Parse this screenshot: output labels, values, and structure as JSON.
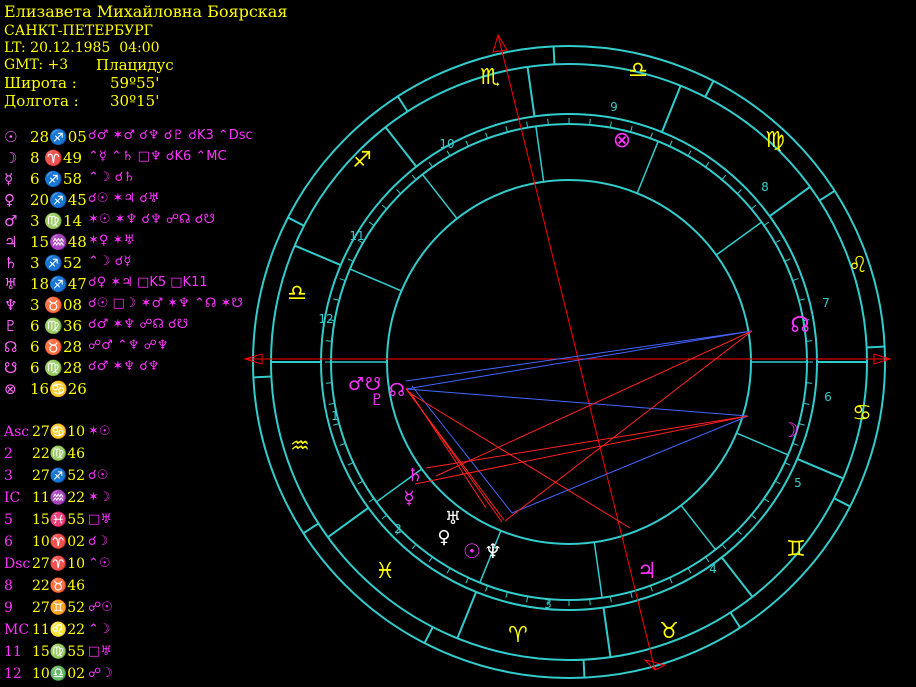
{
  "header": {
    "name": "Елизавета Михайловна Боярская",
    "city": "САНКТ-ПЕТЕРБУРГ",
    "lt": "LT: 20.12.1985  04:00",
    "gmt": "GMT: +3",
    "system": "Плацидус",
    "lat_label": "Широта :",
    "lat_value": "59º55'",
    "lon_label": "Долгота :",
    "lon_value": "30º15'"
  },
  "planets": [
    {
      "glyph": "☉",
      "pos": "28♐05",
      "aspects": "☌♂ ✶♂ ☌♆ ☌♇ ☌K3 ⌃Dsc"
    },
    {
      "glyph": "☽",
      "pos": "8 ♈49",
      "aspects": "⌃☿ ⌃♄ □♆ ☌K6 ⌃MC"
    },
    {
      "glyph": "☿",
      "pos": "6 ♐58",
      "aspects": "⌃☽ ☌♄"
    },
    {
      "glyph": "♀",
      "pos": "20♐45",
      "aspects": "☌☉ ✶♃ ☌♅"
    },
    {
      "glyph": "♂",
      "pos": "3 ♍14",
      "aspects": "✶☉ ✶♆ ☌♆ ☍☊ ☌☋"
    },
    {
      "glyph": "♃",
      "pos": "15♒48",
      "aspects": "✶♀ ✶♅"
    },
    {
      "glyph": "♄",
      "pos": "3 ♐52",
      "aspects": "⌃☽ ☌☿"
    },
    {
      "glyph": "♅",
      "pos": "18♐47",
      "aspects": "☌♀ ✶♃ □K5 □K11"
    },
    {
      "glyph": "♆",
      "pos": "3 ♉08",
      "aspects": "☌☉ □☽ ✶♂ ✶♆ ⌃☊ ✶☋"
    },
    {
      "glyph": "♇",
      "pos": "6 ♍36",
      "aspects": "☌♂ ✶♆ ☍☊ ☌☋"
    },
    {
      "glyph": "☊",
      "pos": "6 ♉28",
      "aspects": "☍♂ ⌃♆ ☍♆"
    },
    {
      "glyph": "☋",
      "pos": "6 ♍28",
      "aspects": "☌♂ ✶♆ ☌♆"
    },
    {
      "glyph": "⊗",
      "pos": "16♋26",
      "aspects": ""
    }
  ],
  "houses": [
    {
      "name": "Asc",
      "pos": "27♋10",
      "aspects": "✶☉"
    },
    {
      "name": "2",
      "pos": "22♍46",
      "aspects": ""
    },
    {
      "name": "3",
      "pos": "27♐52",
      "aspects": "☌☉"
    },
    {
      "name": "IC",
      "pos": "11♒22",
      "aspects": "✶☽"
    },
    {
      "name": "5",
      "pos": "15♓55",
      "aspects": "□♅"
    },
    {
      "name": "6",
      "pos": "10♈02",
      "aspects": "☌☽"
    },
    {
      "name": "Dsc",
      "pos": "27♈10",
      "aspects": "⌃☉"
    },
    {
      "name": "8",
      "pos": "22♉46",
      "aspects": ""
    },
    {
      "name": "9",
      "pos": "27♊52",
      "aspects": "☍☉"
    },
    {
      "name": "MC",
      "pos": "11♌22",
      "aspects": "⌃☽"
    },
    {
      "name": "11",
      "pos": "15♍55",
      "aspects": "□♅"
    },
    {
      "name": "12",
      "pos": "10♎02",
      "aspects": "☍☽"
    }
  ],
  "wheel": {
    "house_numbers": [
      "1",
      "2",
      "3",
      "4",
      "5",
      "6",
      "7",
      "8",
      "9",
      "10",
      "11",
      "12"
    ],
    "signs": [
      "♋",
      "♌",
      "♍",
      "♎",
      "♏",
      "♐",
      "♑",
      "♒",
      "♓",
      "♈",
      "♉",
      "♊"
    ],
    "planet_glyphs": {
      "sun": "☉",
      "moon": "☽",
      "mercury": "☿",
      "venus": "♀",
      "mars": "♂",
      "jupiter": "♃",
      "saturn": "♄",
      "uranus": "♅",
      "neptune": "♆",
      "pluto": "♇",
      "node": "☊",
      "south_node": "☋",
      "fortune": "⊗"
    },
    "colors": {
      "ring": "#33cccc",
      "sign": "#ffff00",
      "planet": "#ff33ff",
      "axis": "#ff0000",
      "aspect_blue": "#4466ff",
      "aspect_red": "#ff2222"
    }
  }
}
